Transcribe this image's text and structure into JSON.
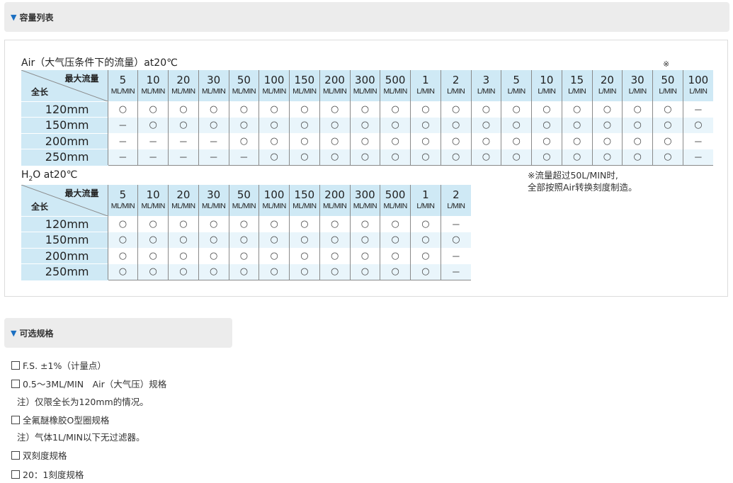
{
  "section1": {
    "title": "容量列表",
    "icon": "triangle-down-icon"
  },
  "section2": {
    "title": "可选规格",
    "icon": "triangle-down-icon"
  },
  "corner": {
    "top": "最大流量",
    "bottom": "全长"
  },
  "air": {
    "title": "Air（大气压条件下的流量）at20℃",
    "note_mark": "※",
    "columns": [
      {
        "num": "5",
        "unit": "ML/MIN"
      },
      {
        "num": "10",
        "unit": "ML/MIN"
      },
      {
        "num": "20",
        "unit": "ML/MIN"
      },
      {
        "num": "30",
        "unit": "ML/MIN"
      },
      {
        "num": "50",
        "unit": "ML/MIN"
      },
      {
        "num": "100",
        "unit": "ML/MIN"
      },
      {
        "num": "150",
        "unit": "ML/MIN"
      },
      {
        "num": "200",
        "unit": "ML/MIN"
      },
      {
        "num": "300",
        "unit": "ML/MIN"
      },
      {
        "num": "500",
        "unit": "ML/MIN"
      },
      {
        "num": "1",
        "unit": "L/MIN"
      },
      {
        "num": "2",
        "unit": "L/MIN"
      },
      {
        "num": "3",
        "unit": "L/MIN"
      },
      {
        "num": "5",
        "unit": "L/MIN"
      },
      {
        "num": "10",
        "unit": "L/MIN"
      },
      {
        "num": "15",
        "unit": "L/MIN"
      },
      {
        "num": "20",
        "unit": "L/MIN"
      },
      {
        "num": "30",
        "unit": "L/MIN"
      },
      {
        "num": "50",
        "unit": "L/MIN"
      },
      {
        "num": "100",
        "unit": "L/MIN"
      }
    ],
    "rows": [
      {
        "label": "120mm",
        "cells": [
          "○",
          "○",
          "○",
          "○",
          "○",
          "○",
          "○",
          "○",
          "○",
          "○",
          "○",
          "○",
          "○",
          "○",
          "○",
          "○",
          "○",
          "○",
          "○",
          "－"
        ]
      },
      {
        "label": "150mm",
        "cells": [
          "－",
          "○",
          "○",
          "○",
          "○",
          "○",
          "○",
          "○",
          "○",
          "○",
          "○",
          "○",
          "○",
          "○",
          "○",
          "○",
          "○",
          "○",
          "○",
          "○"
        ]
      },
      {
        "label": "200mm",
        "cells": [
          "－",
          "－",
          "－",
          "－",
          "○",
          "○",
          "○",
          "○",
          "○",
          "○",
          "○",
          "○",
          "○",
          "○",
          "○",
          "○",
          "○",
          "○",
          "○",
          "－"
        ]
      },
      {
        "label": "250mm",
        "cells": [
          "－",
          "－",
          "－",
          "－",
          "－",
          "○",
          "○",
          "○",
          "○",
          "○",
          "○",
          "○",
          "○",
          "○",
          "○",
          "○",
          "○",
          "○",
          "○",
          "－"
        ]
      }
    ]
  },
  "h2o": {
    "title_prefix": "H",
    "title_sub": "2",
    "title_suffix": "O at20℃",
    "columns": [
      {
        "num": "5",
        "unit": "ML/MIN"
      },
      {
        "num": "10",
        "unit": "ML/MIN"
      },
      {
        "num": "20",
        "unit": "ML/MIN"
      },
      {
        "num": "30",
        "unit": "ML/MIN"
      },
      {
        "num": "50",
        "unit": "ML/MIN"
      },
      {
        "num": "100",
        "unit": "ML/MIN"
      },
      {
        "num": "150",
        "unit": "ML/MIN"
      },
      {
        "num": "200",
        "unit": "ML/MIN"
      },
      {
        "num": "300",
        "unit": "ML/MIN"
      },
      {
        "num": "500",
        "unit": "ML/MIN"
      },
      {
        "num": "1",
        "unit": "L/MIN"
      },
      {
        "num": "2",
        "unit": "L/MIN"
      }
    ],
    "rows": [
      {
        "label": "120mm",
        "cells": [
          "○",
          "○",
          "○",
          "○",
          "○",
          "○",
          "○",
          "○",
          "○",
          "○",
          "○",
          "－"
        ]
      },
      {
        "label": "150mm",
        "cells": [
          "○",
          "○",
          "○",
          "○",
          "○",
          "○",
          "○",
          "○",
          "○",
          "○",
          "○",
          "○"
        ]
      },
      {
        "label": "200mm",
        "cells": [
          "○",
          "○",
          "○",
          "○",
          "○",
          "○",
          "○",
          "○",
          "○",
          "○",
          "○",
          "－"
        ]
      },
      {
        "label": "250mm",
        "cells": [
          "○",
          "○",
          "○",
          "○",
          "○",
          "○",
          "○",
          "○",
          "○",
          "○",
          "○",
          "－"
        ]
      }
    ]
  },
  "note": {
    "line1": "※流量超过50L/MIN时,",
    "line2": "全部按照Air转换刻度制造。"
  },
  "options": [
    {
      "text": "F.S. ±1%（计量点）",
      "checkbox": true
    },
    {
      "text": "0.5～3ML/MIN　Air（大气压）规格",
      "checkbox": true
    },
    {
      "text": "注）仅限全长为120mm的情况。",
      "checkbox": false
    },
    {
      "text": "全氟醚橡胶O型圈规格",
      "checkbox": true
    },
    {
      "text": "注）气体1L/MIN以下无过滤器。",
      "checkbox": false
    },
    {
      "text": "双刻度规格",
      "checkbox": true
    },
    {
      "text": "20：1刻度规格",
      "checkbox": true
    }
  ],
  "colors": {
    "accent": "#1b6fc2",
    "header_bg": "#ececec",
    "table_head": "#cfe9f5",
    "row_alt": "#e9f5fb"
  }
}
